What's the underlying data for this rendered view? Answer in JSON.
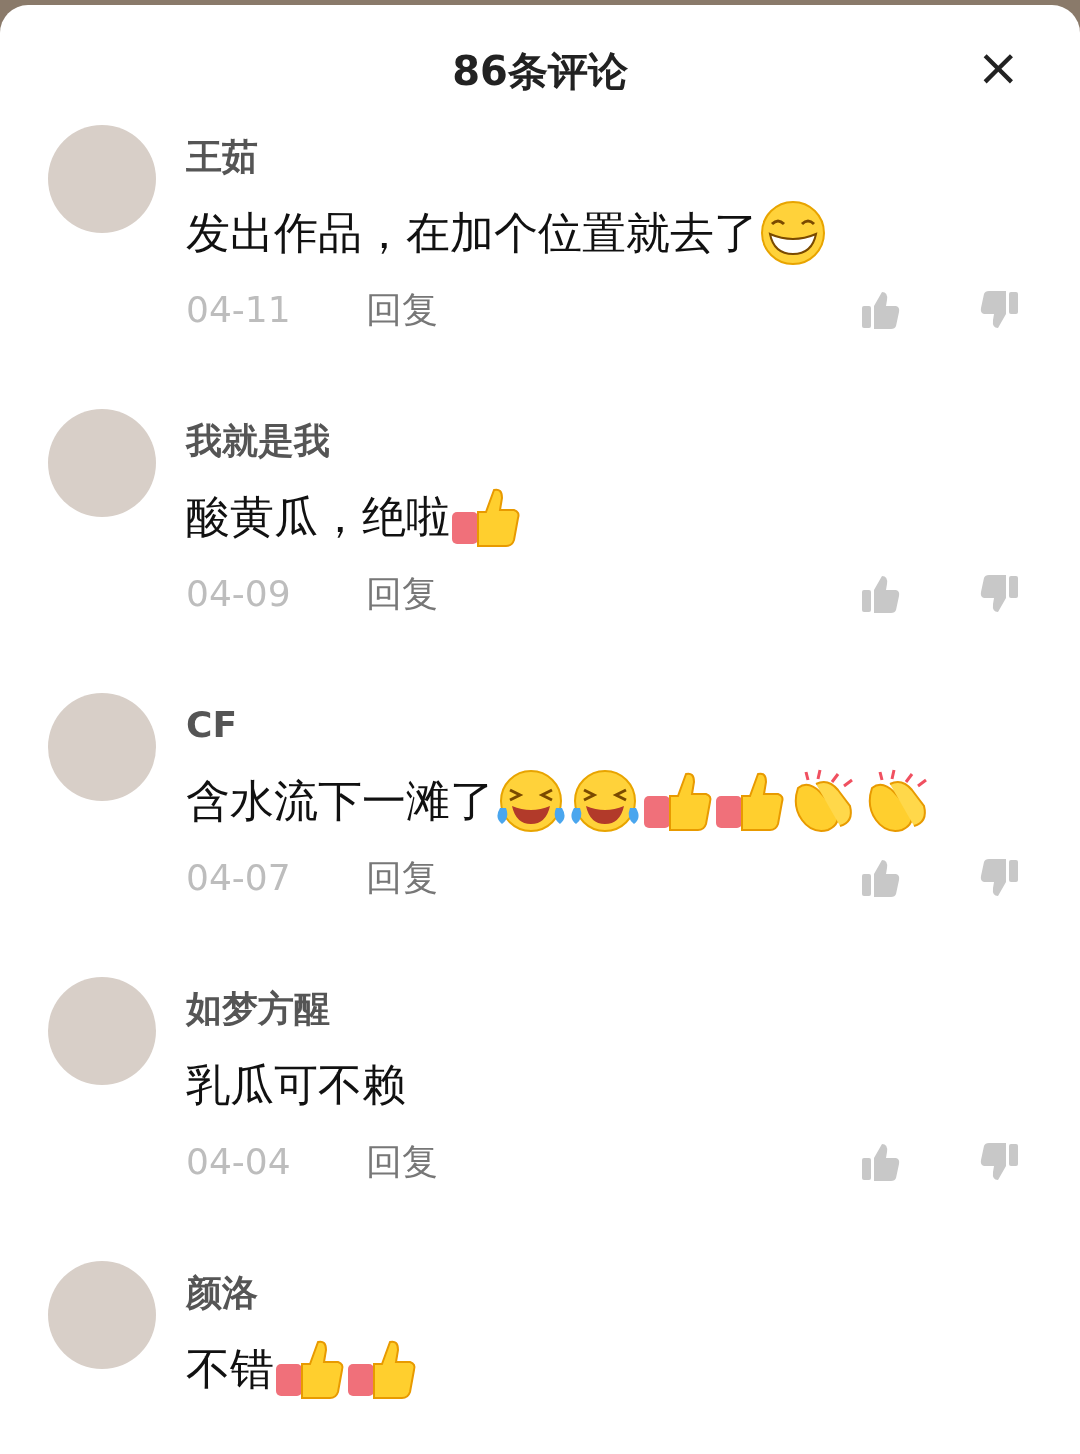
{
  "header": {
    "title": "86条评论",
    "close": "×"
  },
  "comments": [
    {
      "name": "王茹",
      "text": "发出作品，在加个位置就去了",
      "emojis": [
        {
          "kind": "grin"
        }
      ],
      "date": "04-11",
      "reply": "回复"
    },
    {
      "name": "我就是我",
      "text": "酸黄瓜，绝啦",
      "emojis": [
        {
          "kind": "thumbs"
        }
      ],
      "date": "04-09",
      "reply": "回复"
    },
    {
      "name": "CF",
      "text": "含水流下一滩了",
      "emojis": [
        {
          "kind": "laugh"
        },
        {
          "kind": "laugh"
        },
        {
          "kind": "thumbs"
        },
        {
          "kind": "thumbs"
        },
        {
          "kind": "clap"
        },
        {
          "kind": "clap"
        }
      ],
      "date": "04-07",
      "reply": "回复"
    },
    {
      "name": "如梦方醒",
      "text": "乳瓜可不赖",
      "date": "04-04",
      "reply": "回复"
    },
    {
      "name": "颜洛",
      "text": "不错",
      "emojis": [
        {
          "kind": "thumbs"
        },
        {
          "kind": "thumbs"
        }
      ]
    }
  ]
}
